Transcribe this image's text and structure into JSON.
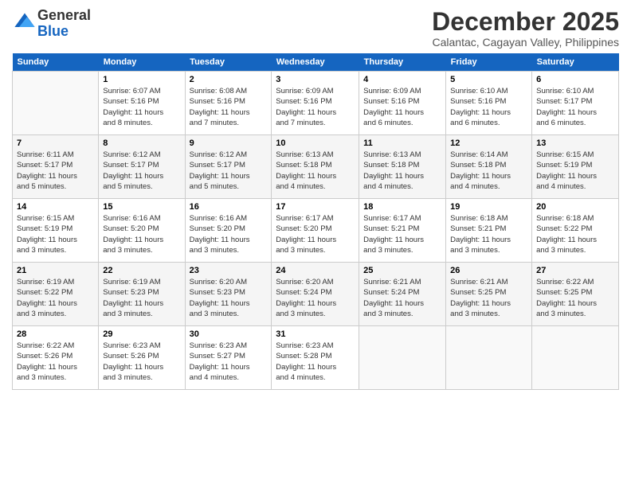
{
  "logo": {
    "general": "General",
    "blue": "Blue"
  },
  "header": {
    "month": "December 2025",
    "location": "Calantac, Cagayan Valley, Philippines"
  },
  "weekdays": [
    "Sunday",
    "Monday",
    "Tuesday",
    "Wednesday",
    "Thursday",
    "Friday",
    "Saturday"
  ],
  "weeks": [
    [
      {
        "day": "",
        "info": ""
      },
      {
        "day": "1",
        "info": "Sunrise: 6:07 AM\nSunset: 5:16 PM\nDaylight: 11 hours\nand 8 minutes."
      },
      {
        "day": "2",
        "info": "Sunrise: 6:08 AM\nSunset: 5:16 PM\nDaylight: 11 hours\nand 7 minutes."
      },
      {
        "day": "3",
        "info": "Sunrise: 6:09 AM\nSunset: 5:16 PM\nDaylight: 11 hours\nand 7 minutes."
      },
      {
        "day": "4",
        "info": "Sunrise: 6:09 AM\nSunset: 5:16 PM\nDaylight: 11 hours\nand 6 minutes."
      },
      {
        "day": "5",
        "info": "Sunrise: 6:10 AM\nSunset: 5:16 PM\nDaylight: 11 hours\nand 6 minutes."
      },
      {
        "day": "6",
        "info": "Sunrise: 6:10 AM\nSunset: 5:17 PM\nDaylight: 11 hours\nand 6 minutes."
      }
    ],
    [
      {
        "day": "7",
        "info": "Sunrise: 6:11 AM\nSunset: 5:17 PM\nDaylight: 11 hours\nand 5 minutes."
      },
      {
        "day": "8",
        "info": "Sunrise: 6:12 AM\nSunset: 5:17 PM\nDaylight: 11 hours\nand 5 minutes."
      },
      {
        "day": "9",
        "info": "Sunrise: 6:12 AM\nSunset: 5:17 PM\nDaylight: 11 hours\nand 5 minutes."
      },
      {
        "day": "10",
        "info": "Sunrise: 6:13 AM\nSunset: 5:18 PM\nDaylight: 11 hours\nand 4 minutes."
      },
      {
        "day": "11",
        "info": "Sunrise: 6:13 AM\nSunset: 5:18 PM\nDaylight: 11 hours\nand 4 minutes."
      },
      {
        "day": "12",
        "info": "Sunrise: 6:14 AM\nSunset: 5:18 PM\nDaylight: 11 hours\nand 4 minutes."
      },
      {
        "day": "13",
        "info": "Sunrise: 6:15 AM\nSunset: 5:19 PM\nDaylight: 11 hours\nand 4 minutes."
      }
    ],
    [
      {
        "day": "14",
        "info": "Sunrise: 6:15 AM\nSunset: 5:19 PM\nDaylight: 11 hours\nand 3 minutes."
      },
      {
        "day": "15",
        "info": "Sunrise: 6:16 AM\nSunset: 5:20 PM\nDaylight: 11 hours\nand 3 minutes."
      },
      {
        "day": "16",
        "info": "Sunrise: 6:16 AM\nSunset: 5:20 PM\nDaylight: 11 hours\nand 3 minutes."
      },
      {
        "day": "17",
        "info": "Sunrise: 6:17 AM\nSunset: 5:20 PM\nDaylight: 11 hours\nand 3 minutes."
      },
      {
        "day": "18",
        "info": "Sunrise: 6:17 AM\nSunset: 5:21 PM\nDaylight: 11 hours\nand 3 minutes."
      },
      {
        "day": "19",
        "info": "Sunrise: 6:18 AM\nSunset: 5:21 PM\nDaylight: 11 hours\nand 3 minutes."
      },
      {
        "day": "20",
        "info": "Sunrise: 6:18 AM\nSunset: 5:22 PM\nDaylight: 11 hours\nand 3 minutes."
      }
    ],
    [
      {
        "day": "21",
        "info": "Sunrise: 6:19 AM\nSunset: 5:22 PM\nDaylight: 11 hours\nand 3 minutes."
      },
      {
        "day": "22",
        "info": "Sunrise: 6:19 AM\nSunset: 5:23 PM\nDaylight: 11 hours\nand 3 minutes."
      },
      {
        "day": "23",
        "info": "Sunrise: 6:20 AM\nSunset: 5:23 PM\nDaylight: 11 hours\nand 3 minutes."
      },
      {
        "day": "24",
        "info": "Sunrise: 6:20 AM\nSunset: 5:24 PM\nDaylight: 11 hours\nand 3 minutes."
      },
      {
        "day": "25",
        "info": "Sunrise: 6:21 AM\nSunset: 5:24 PM\nDaylight: 11 hours\nand 3 minutes."
      },
      {
        "day": "26",
        "info": "Sunrise: 6:21 AM\nSunset: 5:25 PM\nDaylight: 11 hours\nand 3 minutes."
      },
      {
        "day": "27",
        "info": "Sunrise: 6:22 AM\nSunset: 5:25 PM\nDaylight: 11 hours\nand 3 minutes."
      }
    ],
    [
      {
        "day": "28",
        "info": "Sunrise: 6:22 AM\nSunset: 5:26 PM\nDaylight: 11 hours\nand 3 minutes."
      },
      {
        "day": "29",
        "info": "Sunrise: 6:23 AM\nSunset: 5:26 PM\nDaylight: 11 hours\nand 3 minutes."
      },
      {
        "day": "30",
        "info": "Sunrise: 6:23 AM\nSunset: 5:27 PM\nDaylight: 11 hours\nand 4 minutes."
      },
      {
        "day": "31",
        "info": "Sunrise: 6:23 AM\nSunset: 5:28 PM\nDaylight: 11 hours\nand 4 minutes."
      },
      {
        "day": "",
        "info": ""
      },
      {
        "day": "",
        "info": ""
      },
      {
        "day": "",
        "info": ""
      }
    ]
  ]
}
